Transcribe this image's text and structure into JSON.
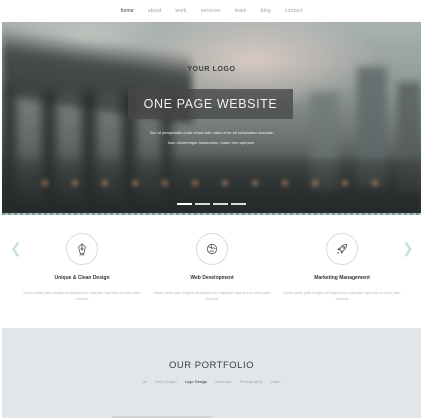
{
  "nav": {
    "items": [
      "home",
      "about",
      "work",
      "services",
      "team",
      "blog",
      "contact"
    ],
    "active_index": 0
  },
  "hero": {
    "logo": "YOUR LOGO",
    "title": "ONE PAGE WEBSITE",
    "text_line1": "Sed ut perspiciatis unde omnis iste natus error sit voluptatem accusan",
    "text_line2": "tium doloremque laudantium, totam rem aperiam.",
    "slide_count": 4,
    "active_slide": 0
  },
  "features": [
    {
      "icon": "pen-nib-icon",
      "title": "Unique & Clean Design",
      "text": "Donec pede justo fringilla vel aliquet nec vulputate eget arcu in enim justo rhoncus"
    },
    {
      "icon": "globe-icon",
      "title": "Web Development",
      "text": "Donec pede justo fringilla vel aliquet nec vulputate eget arcu in enim justo rhoncus"
    },
    {
      "icon": "rocket-icon",
      "title": "Marketing Management",
      "text": "Donec pede justo fringilla vel aliquet nec vulputate eget arcu in enim justo rhoncus"
    }
  ],
  "portfolio": {
    "title": "OUR PORTFOLIO",
    "filters": [
      "All",
      "Web Design",
      "Logo Design",
      "Illustrator",
      "Photography",
      "Video"
    ],
    "active_filter": 2
  },
  "colors": {
    "accent": "#b9d8d2",
    "portfolio_bg": "#e3e6e9"
  }
}
